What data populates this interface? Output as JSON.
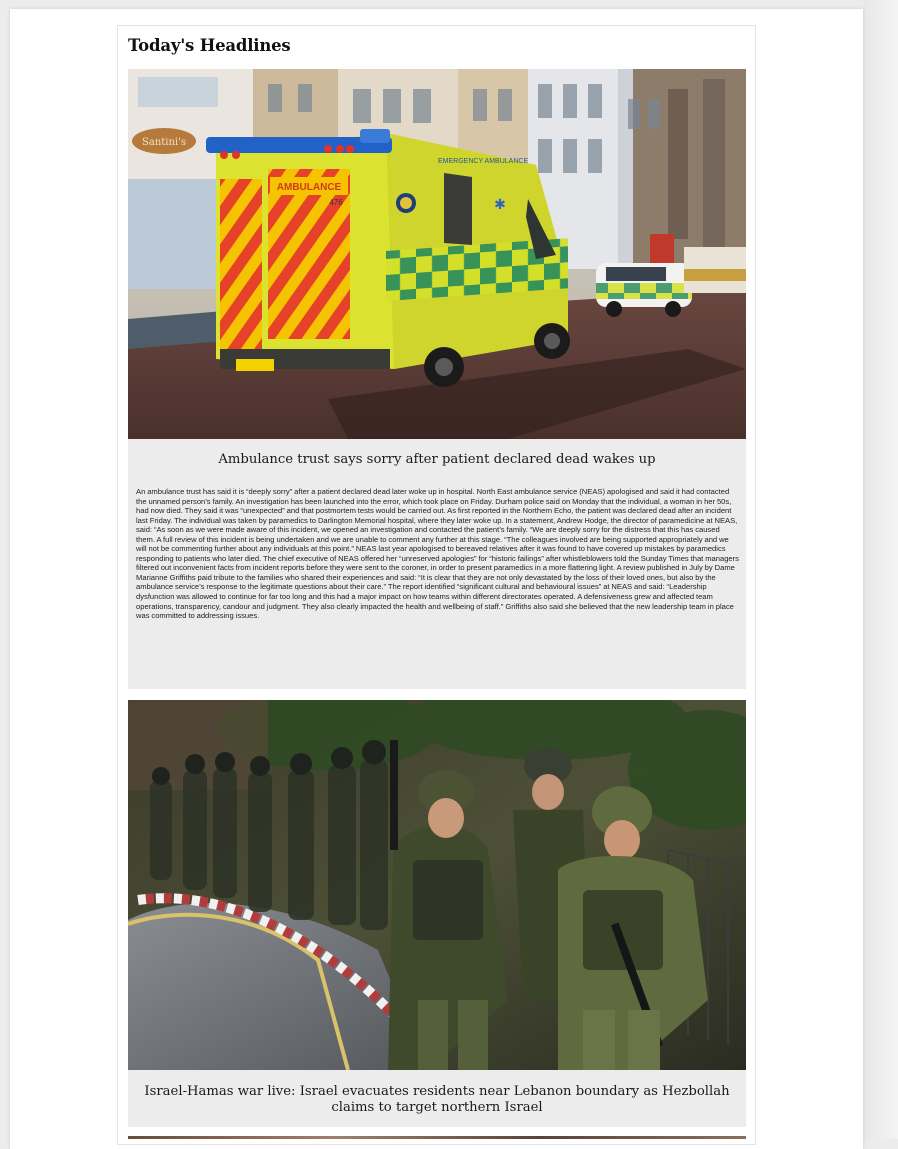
{
  "page": {
    "title": "Today's Headlines"
  },
  "stories": [
    {
      "headline": "Ambulance trust says sorry after patient declared dead wakes up",
      "image_alt": "Yellow and green ambulance with red chevrons parked on a street",
      "image_text": {
        "shop_sign": "Santini's",
        "rear_sign": "AMBULANCE",
        "side_sign": "EMERGENCY AMBULANCE",
        "door_number": "476"
      },
      "body": "An ambulance trust has said it is “deeply sorry” after a patient declared dead later woke up in hospital. North East ambulance service (NEAS) apologised and said it had contacted the unnamed person’s family. An investigation has been launched into the error, which took place on Friday. Durham police said on Monday that the individual, a woman in her 50s, had now died. They said it was “unexpected” and that postmortem tests would be carried out. As first reported in the Northern Echo, the patient was declared dead after an incident last Friday. The individual was taken by paramedics to Darlington Memorial hospital, where they later woke up. In a statement, Andrew Hodge, the director of paramedicine at NEAS, said: “As soon as we were made aware of this incident, we opened an investigation and contacted the patient’s family. “We are deeply sorry for the distress that this has caused them. A full review of this incident is being undertaken and we are unable to comment any further at this stage. “The colleagues involved are being supported appropriately and we will not be commenting further about any individuals at this point.” NEAS last year apologised to bereaved relatives after it was found to have covered up mistakes by paramedics responding to patients who later died. The chief executive of NEAS offered her “unreserved apologies” for “historic failings” after whistleblowers told the Sunday Times that managers filtered out inconvenient facts from incident reports before they were sent to the coroner, in order to present paramedics in a more flattering light. A review published in July by Dame Marianne Griffiths paid tribute to the families who shared their experiences and said: “It is clear that they are not only devastated by the loss of their loved ones, but also by the ambulance service’s response to the legitimate questions about their care.” The report identified “significant cultural and behavioural issues” at NEAS and said: “Leadership dysfunction was allowed to continue for far too long and this had a major impact on how teams within different directorates operated. A defensiveness grew and affected team operations, transparency, candour and judgment. They also clearly impacted the health and wellbeing of staff.” Griffiths also said she believed that the new leadership team in place was committed to addressing issues."
    },
    {
      "headline": "Israel-Hamas war live: Israel evacuates residents near Lebanon boundary as Hezbollah claims to target northern Israel",
      "image_alt": "Soldiers in combat gear walking along a curved road"
    }
  ]
}
